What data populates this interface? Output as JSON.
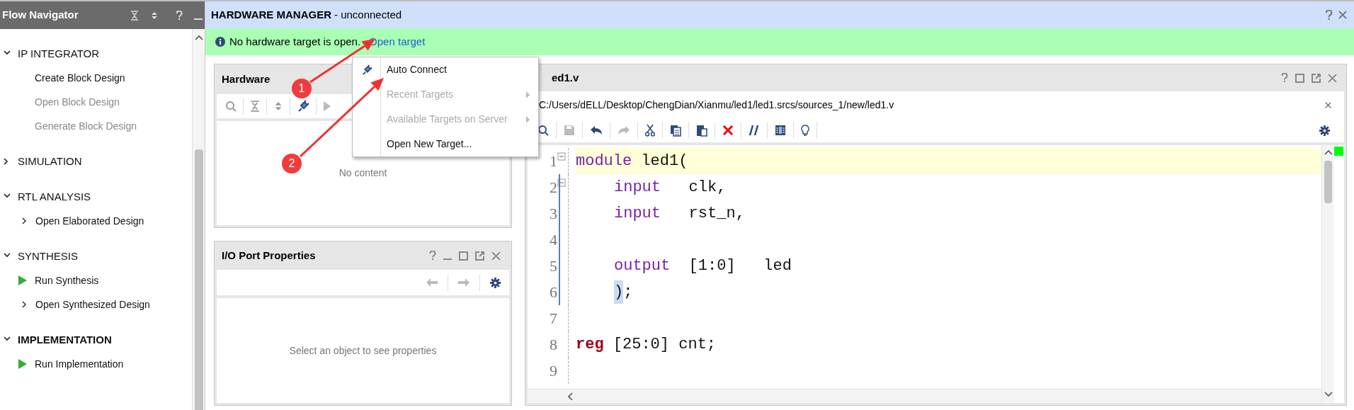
{
  "flow_navigator": {
    "title": "Flow Navigator",
    "sections": [
      {
        "label": "IP INTEGRATOR",
        "expanded": true,
        "selected": false,
        "children": [
          {
            "label": "Create Block Design",
            "kind": "plain",
            "disabled": false
          },
          {
            "label": "Open Block Design",
            "kind": "plain",
            "disabled": true
          },
          {
            "label": "Generate Block Design",
            "kind": "plain",
            "disabled": true
          }
        ]
      },
      {
        "label": "SIMULATION",
        "expanded": false,
        "selected": false
      },
      {
        "label": "RTL ANALYSIS",
        "expanded": true,
        "selected": false,
        "children": [
          {
            "label": "Open Elaborated Design",
            "kind": "expand",
            "disabled": false
          }
        ]
      },
      {
        "label": "SYNTHESIS",
        "expanded": true,
        "selected": false,
        "children": [
          {
            "label": "Run Synthesis",
            "kind": "run",
            "disabled": false
          },
          {
            "label": "Open Synthesized Design",
            "kind": "expand",
            "disabled": false
          }
        ]
      },
      {
        "label": "IMPLEMENTATION",
        "expanded": true,
        "selected": true,
        "children": [
          {
            "label": "Run Implementation",
            "kind": "run",
            "disabled": false
          }
        ]
      }
    ]
  },
  "hardware_manager": {
    "title": "HARDWARE MANAGER",
    "status": "- unconnected",
    "banner": {
      "message": "No hardware target is open.",
      "link": "Open target"
    }
  },
  "hardware_panel": {
    "title": "Hardware",
    "empty_text": "No content"
  },
  "io_port_panel": {
    "title": "I/O Port Properties",
    "empty_text": "Select an object to see properties"
  },
  "context_menu": {
    "items": [
      {
        "label": "Auto Connect",
        "disabled": false,
        "submenu": false,
        "icon": true
      },
      {
        "label": "Recent Targets",
        "disabled": true,
        "submenu": true,
        "icon": false
      },
      {
        "label": "Available Targets on Server",
        "disabled": true,
        "submenu": true,
        "icon": false
      },
      {
        "label": "Open New Target...",
        "disabled": false,
        "submenu": false,
        "icon": false
      }
    ]
  },
  "editor": {
    "tab_title": "ed1.v",
    "path": "C:/Users/dELL/Desktop/ChengDian/Xianmu/led1/led1.srcs/sources_1/new/led1.v",
    "lines": [
      {
        "number": "1",
        "current": true,
        "fold": true,
        "indented": false,
        "tokens": [
          {
            "kind": "keyword",
            "text": "module"
          },
          {
            "kind": "plain",
            "text": " led1("
          }
        ]
      },
      {
        "number": "2",
        "current": false,
        "fold": true,
        "indented": true,
        "tokens": [
          {
            "kind": "keyword",
            "text": "input"
          },
          {
            "kind": "plain",
            "text": "   clk,"
          }
        ]
      },
      {
        "number": "3",
        "current": false,
        "fold": false,
        "indented": true,
        "tokens": [
          {
            "kind": "keyword",
            "text": "input"
          },
          {
            "kind": "plain",
            "text": "   rst_n,"
          }
        ]
      },
      {
        "number": "4",
        "current": false,
        "fold": false
      },
      {
        "number": "5",
        "current": false,
        "fold": false,
        "indented": true,
        "tokens": [
          {
            "kind": "keyword",
            "text": "output"
          },
          {
            "kind": "plain",
            "text": "  [1:0]   led"
          }
        ]
      },
      {
        "number": "6",
        "current": false,
        "fold": false,
        "indented": true,
        "tokens": [
          {
            "kind": "match",
            "text": ")"
          },
          {
            "kind": "plain",
            "text": ";"
          }
        ]
      },
      {
        "number": "7",
        "current": false,
        "fold": false
      },
      {
        "number": "8",
        "current": false,
        "fold": false,
        "indented": false,
        "tokens": [
          {
            "kind": "type",
            "text": "reg"
          },
          {
            "kind": "plain",
            "text": " [25:0] cnt;"
          }
        ]
      },
      {
        "number": "9",
        "current": false,
        "fold": false
      }
    ]
  },
  "annotations": [
    {
      "label": "1"
    },
    {
      "label": "2"
    }
  ]
}
